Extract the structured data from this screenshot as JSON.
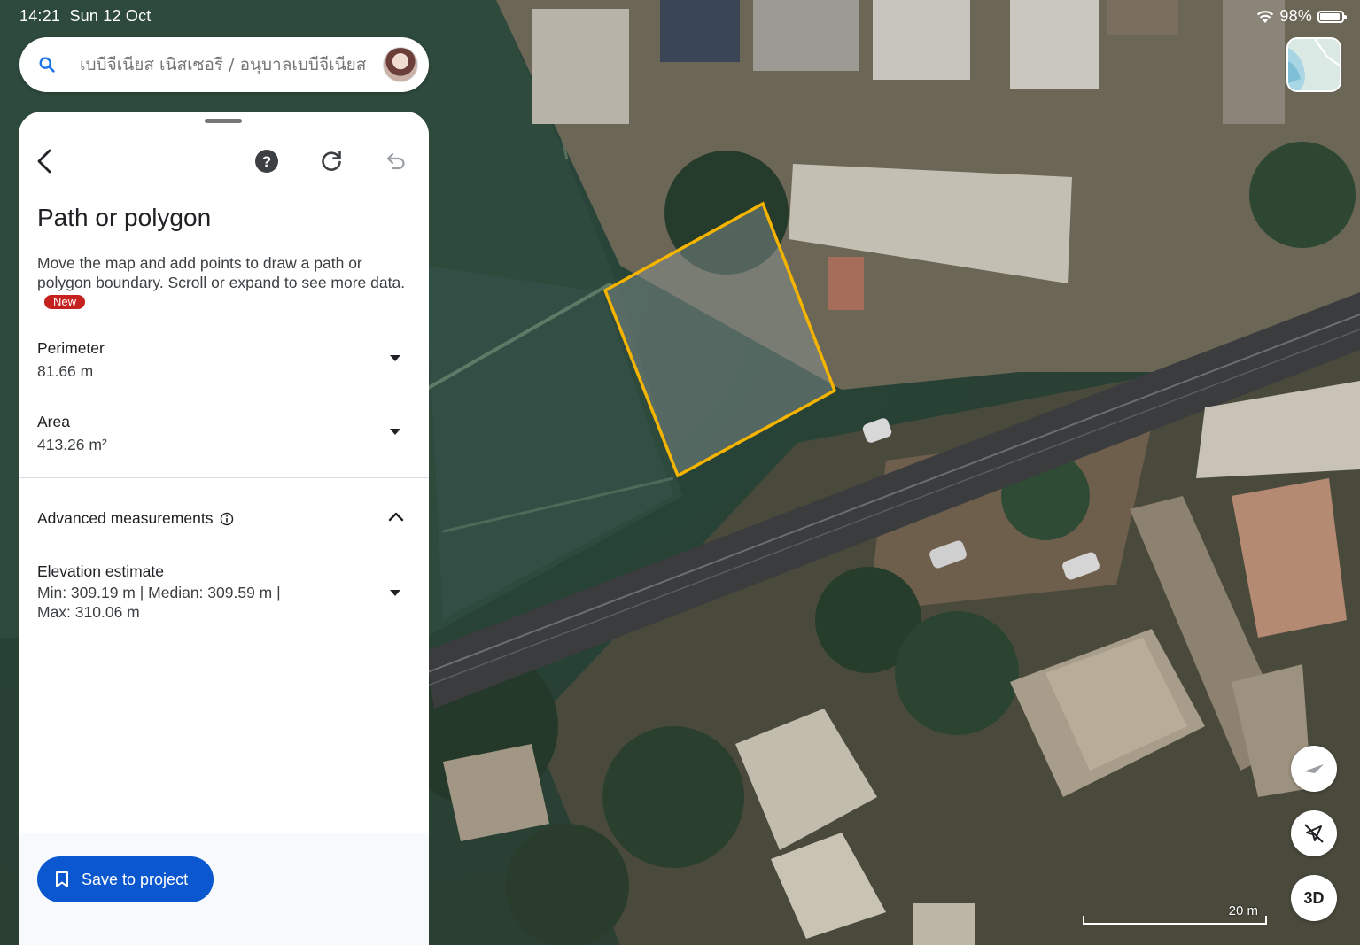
{
  "status_bar": {
    "time": "14:21",
    "date": "Sun 12 Oct",
    "battery": "98%"
  },
  "search": {
    "placeholder": "เบบีจีเนียส เนิสเซอรี / อนุบาลเบบีจีเนียส"
  },
  "panel": {
    "title": "Path or polygon",
    "description": "Move the map and add points to draw a path or polygon boundary. Scroll or expand to see more data.",
    "new_badge": "New",
    "perimeter": {
      "label": "Perimeter",
      "value": "81.66 m"
    },
    "area": {
      "label": "Area",
      "value": "413.26 m²"
    },
    "advanced": {
      "label": "Advanced measurements"
    },
    "elevation": {
      "label": "Elevation estimate",
      "line1": "Min: 309.19 m | Median: 309.59 m |",
      "line2": "Max: 310.06 m"
    },
    "save_label": "Save to project"
  },
  "map": {
    "scale_label": "20 m",
    "btn_3d": "3D",
    "polygon_color": "#f4b400"
  },
  "icons": [
    "search-icon",
    "back-arrow-icon",
    "help-icon",
    "refresh-icon",
    "undo-icon",
    "info-icon",
    "chevron-up-icon",
    "bookmark-icon",
    "compass-icon",
    "location-off-icon",
    "wifi-icon",
    "battery-icon"
  ]
}
